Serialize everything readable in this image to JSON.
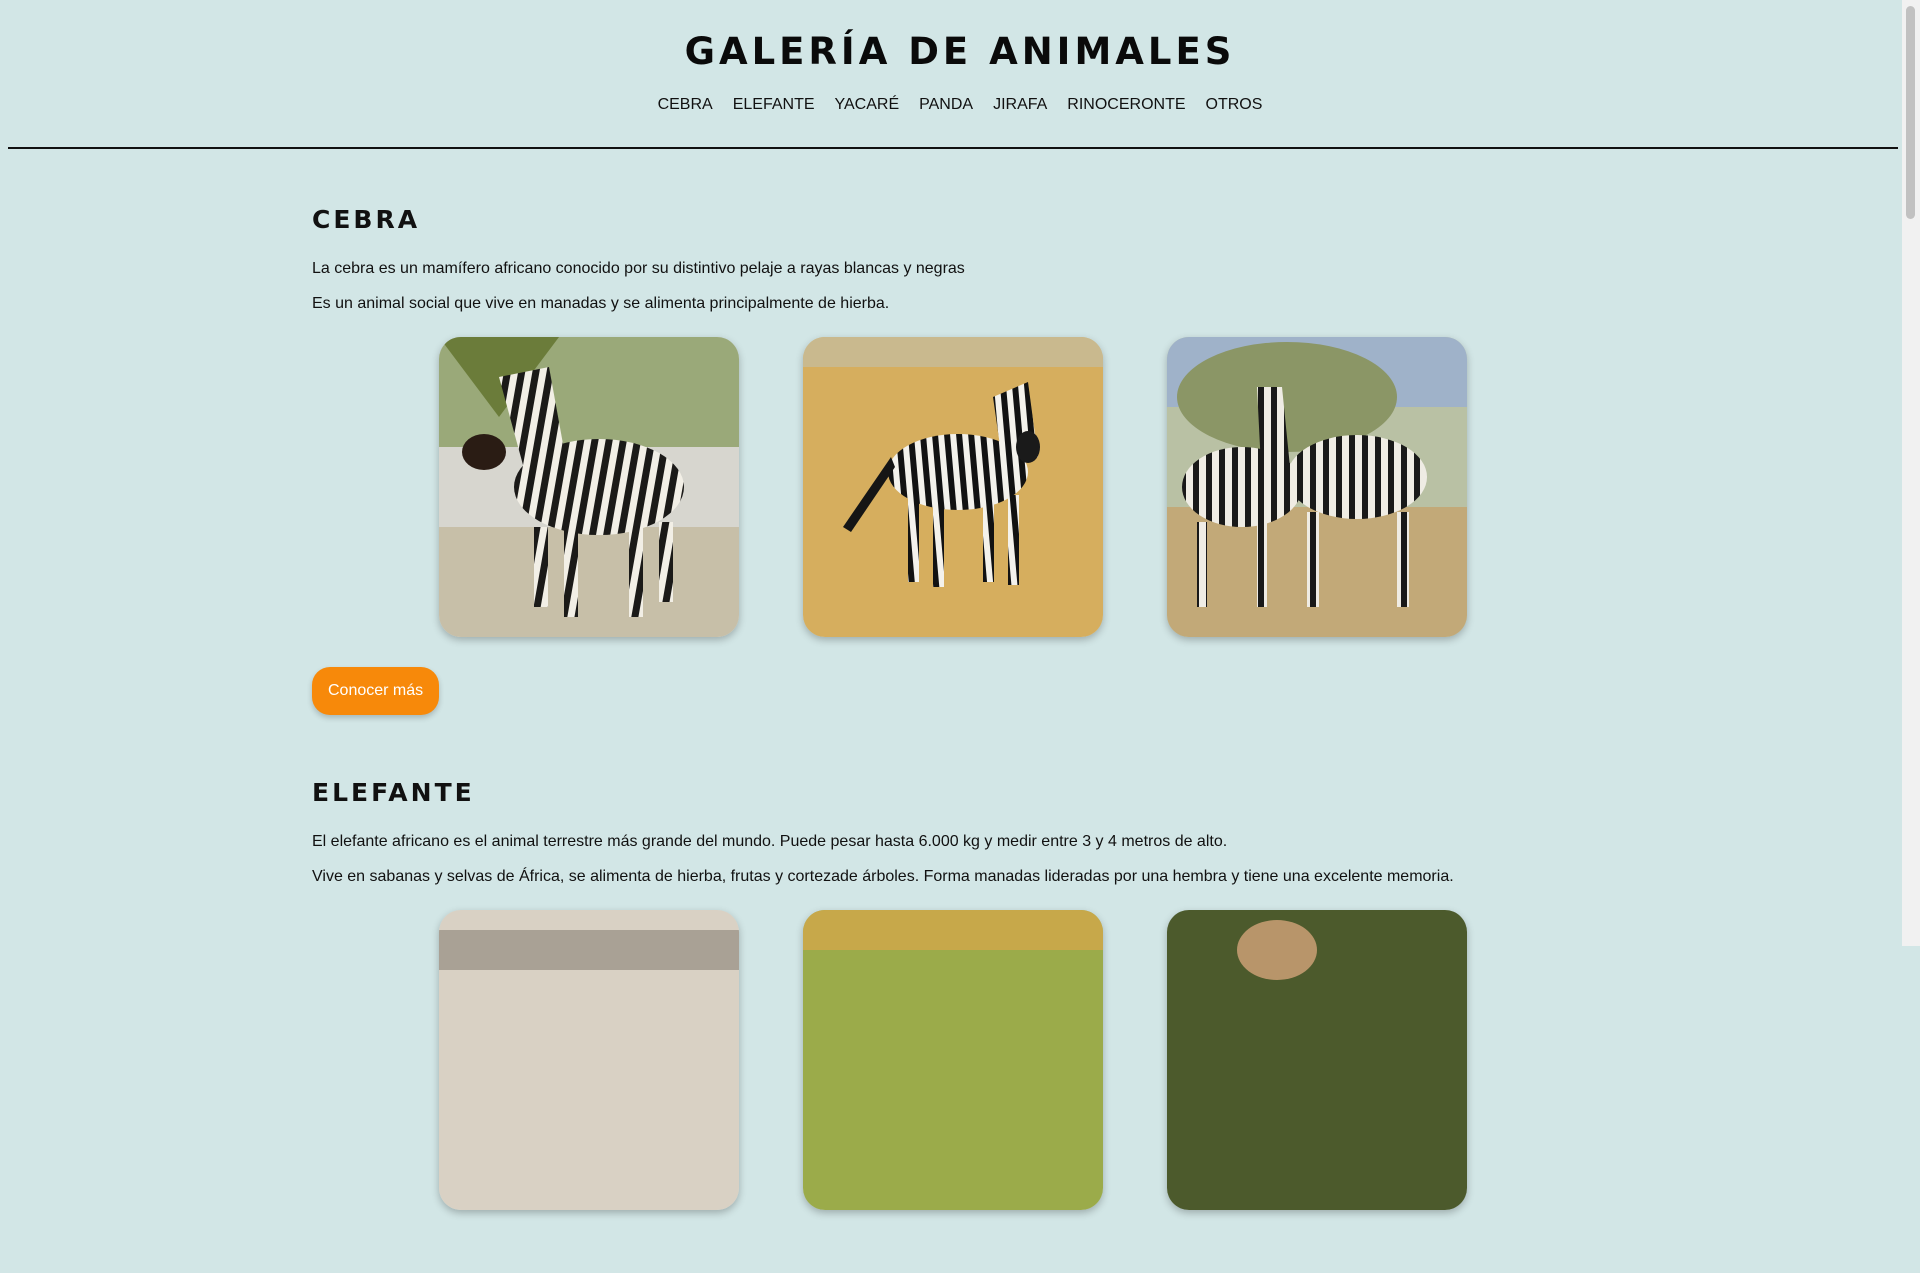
{
  "site": {
    "title": "GALERÍA DE ANIMALES"
  },
  "nav": {
    "items": [
      {
        "label": "CEBRA"
      },
      {
        "label": "ELEFANTE"
      },
      {
        "label": "YACARÉ"
      },
      {
        "label": "PANDA"
      },
      {
        "label": "JIRAFA"
      },
      {
        "label": "RINOCERONTE"
      },
      {
        "label": "OTROS"
      }
    ]
  },
  "sections": [
    {
      "title": "CEBRA",
      "paragraphs": [
        "La cebra es un mamífero africano conocido por su distintivo pelaje a rayas blancas y negras",
        "Es un animal social que vive en manadas y se alimenta principalmente de hierba."
      ],
      "button": "Conocer más"
    },
    {
      "title": "ELEFANTE",
      "paragraphs": [
        "El elefante africano es el animal terrestre más grande del mundo. Puede pesar hasta 6.000 kg y medir entre 3 y 4 metros de alto.",
        "Vive en sabanas y selvas de África, se alimenta de hierba, frutas y cortezade árboles. Forma manadas lideradas por una hembra y tiene una excelente memoria."
      ]
    }
  ],
  "colors": {
    "background": "#d2e6e6",
    "accent": "#f7890a"
  }
}
